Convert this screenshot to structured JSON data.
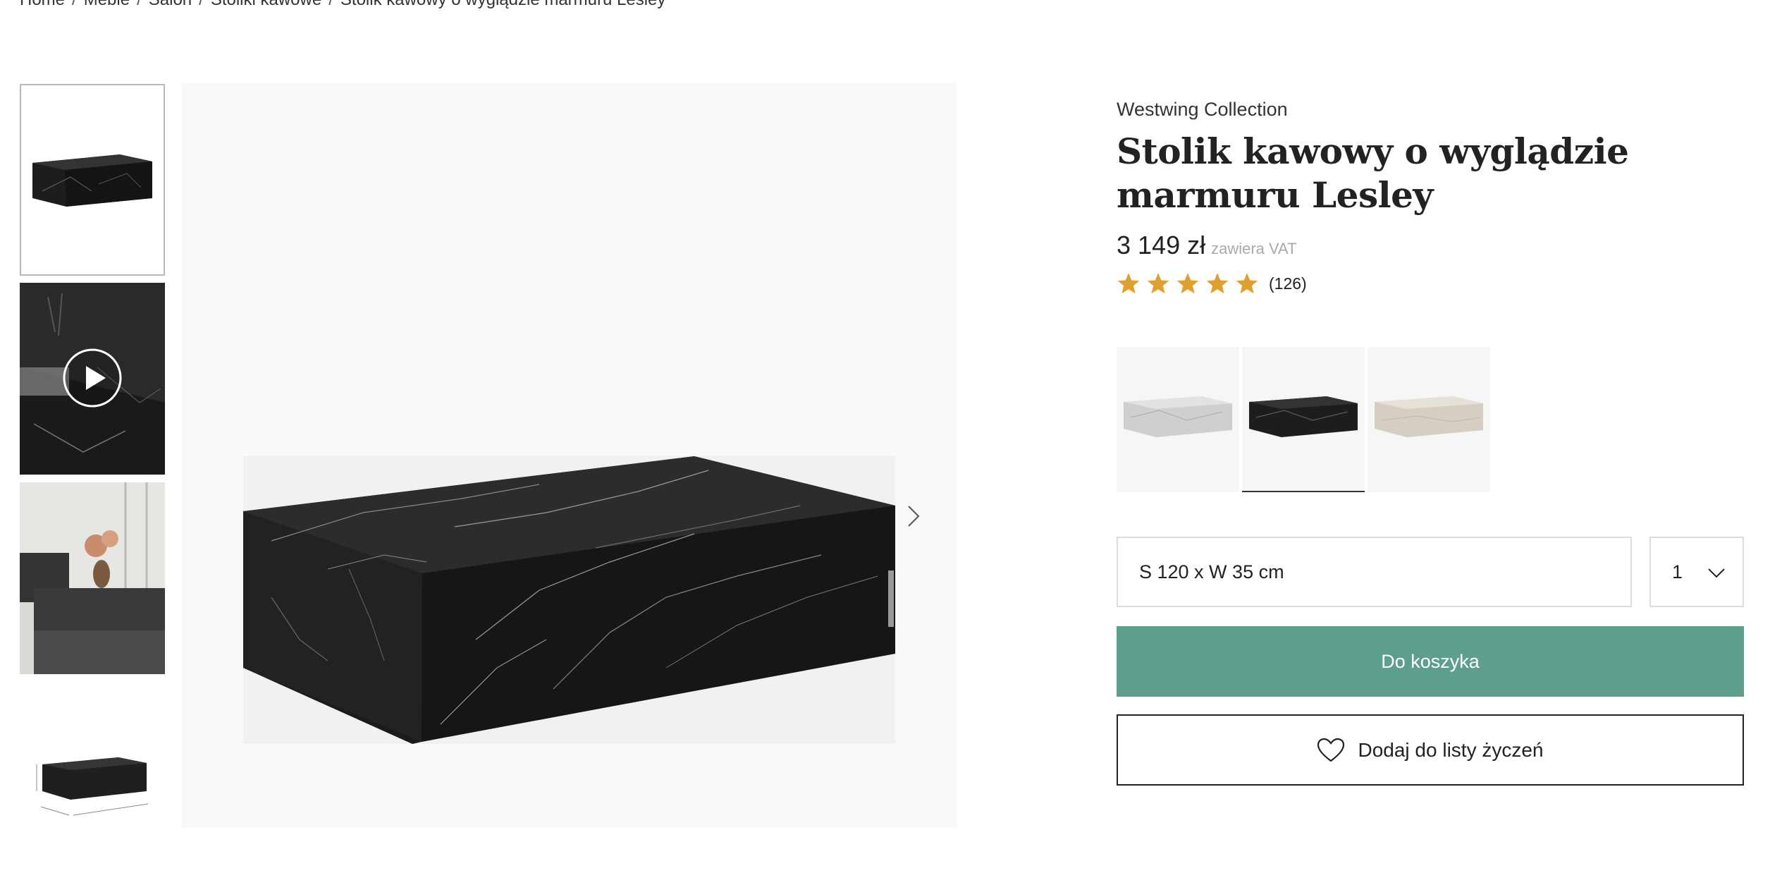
{
  "breadcrumb": {
    "items": [
      "Home",
      "Meble",
      "Salon",
      "Stoliki kawowe",
      "Stolik kawowy o wyglądzie marmuru Lesley"
    ],
    "separator": "/"
  },
  "thumbnails": [
    {
      "label": "black-marble-table-front",
      "active": true
    },
    {
      "label": "video-thumbnail",
      "icon": "play-icon"
    },
    {
      "label": "living-room-scene"
    },
    {
      "label": "dimensions-drawing"
    }
  ],
  "gallery": {
    "next_icon": "chevron-right-icon"
  },
  "product": {
    "brand": "Westwing Collection",
    "title": "Stolik kawowy o wyglądzie marmuru Lesley",
    "price": "3 149 zł",
    "vat_note": "zawiera VAT",
    "rating_stars": 5,
    "rating_count": "(126)"
  },
  "variants": [
    {
      "name": "white-marble",
      "color": "#d9d9d9",
      "active": false
    },
    {
      "name": "black-marble",
      "color": "#1e1e1e",
      "active": true
    },
    {
      "name": "beige-travertine",
      "color": "#d8d2c6",
      "active": false
    }
  ],
  "size": {
    "value": "S 120 x W 35 cm"
  },
  "quantity": {
    "value": "1"
  },
  "buttons": {
    "add_to_cart": "Do koszyka",
    "wishlist": "Dodaj do listy życzeń"
  },
  "colors": {
    "accent": "#5e9e8d",
    "star": "#e0a030"
  }
}
